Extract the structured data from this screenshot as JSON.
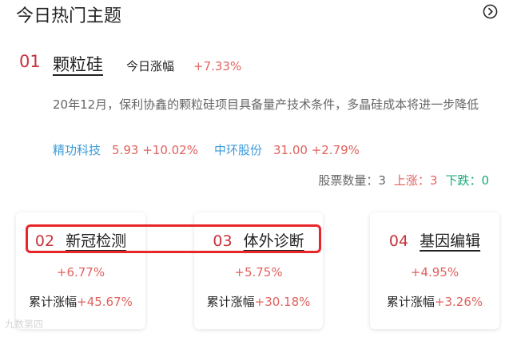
{
  "header": {
    "title": "今日热门主题"
  },
  "featured": {
    "rank": "01",
    "name": "颗粒硅",
    "change_label": "今日涨幅",
    "change_value": "+7.33%",
    "description": "20年12月，保利协鑫的颗粒硅项目具备量产技术条件，多晶硅成本将进一步降低",
    "stocks": [
      {
        "name": "精功科技",
        "price": "5.93",
        "change": "+10.02%"
      },
      {
        "name": "中环股份",
        "price": "31.00",
        "change": "+2.79%"
      }
    ],
    "stats": {
      "count_label": "股票数量：",
      "count": "3",
      "up_label": "上涨：",
      "up": "3",
      "down_label": "下跌：",
      "down": "0"
    }
  },
  "cards": [
    {
      "rank": "02",
      "name": "新冠检测",
      "change": "+6.77%",
      "cum_label": "累计涨幅",
      "cum_value": "+45.67%"
    },
    {
      "rank": "03",
      "name": "体外诊断",
      "change": "+5.75%",
      "cum_label": "累计涨幅",
      "cum_value": "+30.18%"
    },
    {
      "rank": "04",
      "name": "基因编辑",
      "change": "+4.95%",
      "cum_label": "累计涨幅",
      "cum_value": "+3.26%"
    }
  ],
  "watermark": {
    "text": "九数第四"
  },
  "colors": {
    "rise": "#e0625e",
    "fall": "#1aa97b",
    "link": "#3a9bd9",
    "rank": "#c8323c",
    "highlight": "#e8262a"
  },
  "icons": {
    "more": "chevron-right-circle-icon"
  }
}
